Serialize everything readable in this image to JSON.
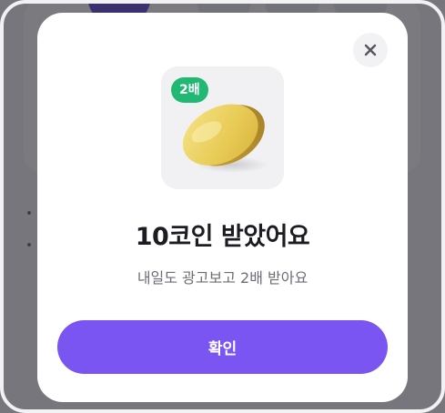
{
  "modal": {
    "badge": "2배",
    "title": "10코인 받았어요",
    "subtitle": "내일도 광고보고 2배 받아요",
    "confirm_label": "확인"
  },
  "colors": {
    "accent": "#7b55f2",
    "badge": "#21b873",
    "coin": "#e9cc58"
  },
  "icons": {
    "close": "close-icon",
    "coin": "coin-icon"
  }
}
